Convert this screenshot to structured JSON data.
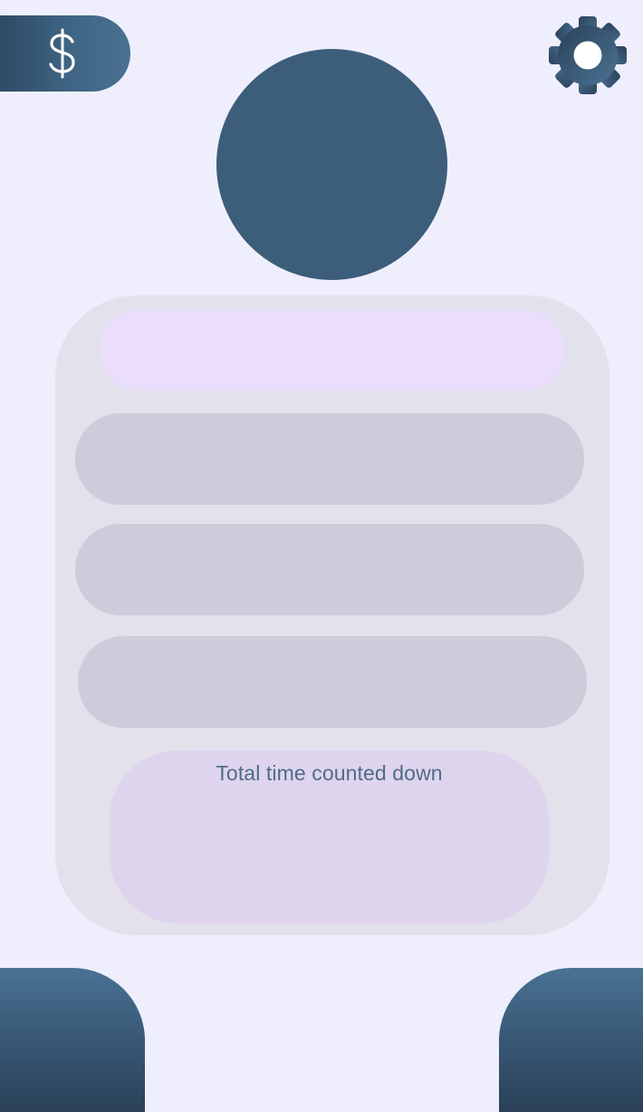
{
  "header": {
    "shop_button": {
      "icon": "dollar-icon",
      "glyph": "$"
    },
    "settings_button": {
      "icon": "gear-icon"
    }
  },
  "profile": {
    "avatar_color": "#3c5e7a"
  },
  "panel": {
    "name_field": {
      "value": ""
    },
    "timer_slots": [
      "",
      "",
      ""
    ],
    "total": {
      "label": "Total time counted down",
      "value": ""
    }
  },
  "footer": {
    "left_button": {},
    "right_button": {}
  },
  "colors": {
    "background": "#efeefd",
    "accent_dark": "#2f4b66",
    "accent": "#3c5e7a",
    "panel": "#e2e1ec",
    "slot": "#d0cbdb",
    "name_field": "#ebdefd",
    "total_box": "#dfd4ed",
    "text": "#4f6c88"
  }
}
